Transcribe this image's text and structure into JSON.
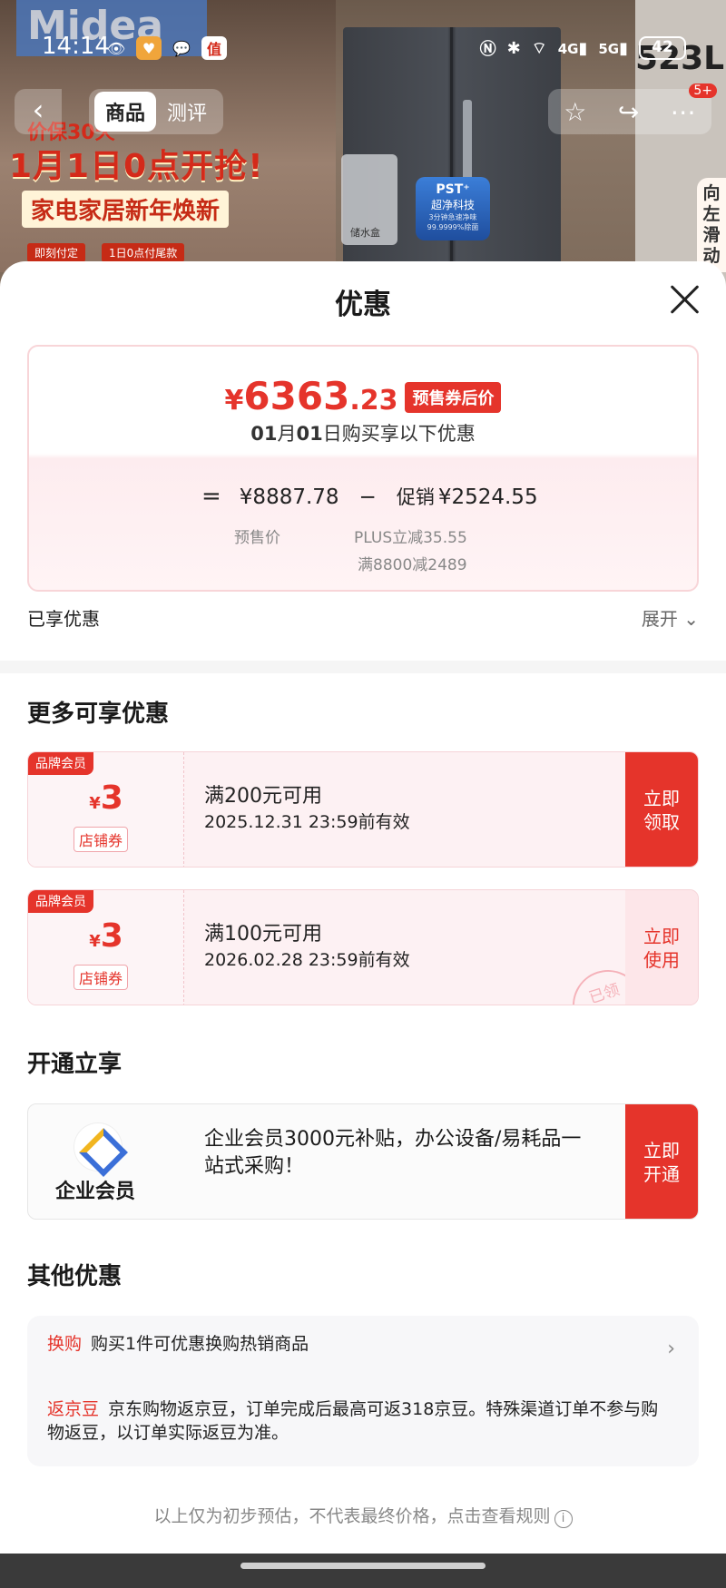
{
  "status_bar": {
    "time": "14:14",
    "network_4g": "4G",
    "network_5g": "5G",
    "battery": "42"
  },
  "product_bg": {
    "brand": "Midea",
    "capacity": "523L",
    "promo_line1": "价保30天",
    "promo_line2": "1月1日0点开抢!",
    "promo_line3": "家电家居新年焕新",
    "promo_tag1": "即刻付定",
    "promo_tag2": "1日0点付尾款",
    "water_box_label": "储水盒",
    "pst_title": "PST⁺",
    "pst_sub": "超净科技",
    "pst_detail": "3分钟急速净味",
    "pst_rate": "99.9999%除菌",
    "side_text": "向左滑动"
  },
  "nav": {
    "back_icon": "back-arrow-icon",
    "tabs": [
      "商品",
      "测评"
    ],
    "notification_badge": "5+"
  },
  "sheet": {
    "title": "优惠",
    "price_card": {
      "final_yen": "¥",
      "final_int": "6363",
      "final_dec": ".23",
      "final_tag": "预售券后价",
      "date_prefix_month": "01",
      "date_month_unit": "月",
      "date_day": "01",
      "date_suffix": "日购买享以下优惠",
      "equals": "=",
      "presale_price": "¥8887.78",
      "presale_label": "预售价",
      "minus": "−",
      "promo_label": "促销",
      "promo_amount": "¥2524.55",
      "promo_detail1": "PLUS立减35.55",
      "promo_detail2": "满8800减2489"
    },
    "enjoyed_label": "已享优惠",
    "expand_label": "展开",
    "more_title": "更多可享优惠",
    "coupons": [
      {
        "brand_tag": "品牌会员",
        "yen": "¥",
        "amount": "3",
        "type_label": "店铺券",
        "condition": "满200元可用",
        "validity": "2025.12.31 23:59前有效",
        "cta": "立即\n领取"
      },
      {
        "brand_tag": "品牌会员",
        "yen": "¥",
        "amount": "3",
        "type_label": "店铺券",
        "condition": "满100元可用",
        "validity": "2026.02.28 23:59前有效",
        "cta": "立即\n使用",
        "stamp": "已领"
      }
    ],
    "open_title": "开通立享",
    "member": {
      "name": "企业会员",
      "desc": "企业会员3000元补贴，办公设备/易耗品一站式采购！",
      "cta": "立即\n开通"
    },
    "other_title": "其他优惠",
    "other_items": [
      {
        "tag": "换购",
        "text": "购买1件可优惠换购热销商品"
      },
      {
        "tag": "返京豆",
        "text": "京东购物返京豆，订单完成后最高可返318京豆。特殊渠道订单不参与购物返豆，以订单实际返豆为准。"
      }
    ],
    "disclaimer": "以上仅为初步预估，不代表最终价格，点击查看规则",
    "info_glyph": "i"
  },
  "colors": {
    "accent_red": "#e5342b",
    "card_pink": "#fdf1f3"
  }
}
